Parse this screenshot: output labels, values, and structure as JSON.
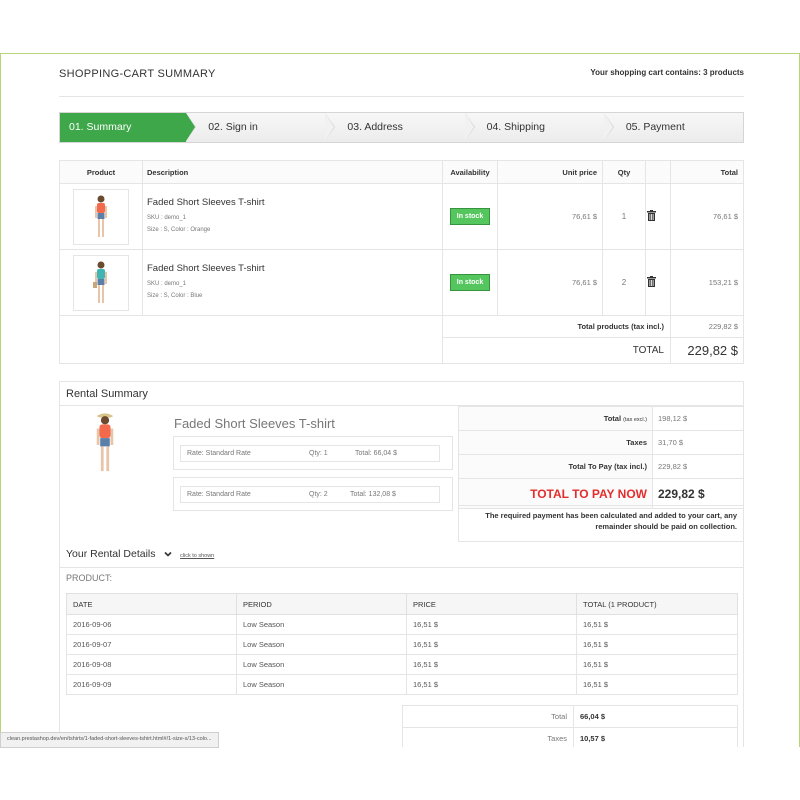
{
  "header": {
    "title": "SHOPPING-CART SUMMARY",
    "cart_count": "Your shopping cart contains: 3 products"
  },
  "steps": [
    {
      "label": "01. Summary"
    },
    {
      "label": "02. Sign in"
    },
    {
      "label": "03. Address"
    },
    {
      "label": "04. Shipping"
    },
    {
      "label": "05. Payment"
    }
  ],
  "cart": {
    "headers": {
      "product": "Product",
      "description": "Description",
      "availability": "Availability",
      "unit_price": "Unit price",
      "qty": "Qty",
      "total": "Total"
    },
    "rows": [
      {
        "name": "Faded Short Sleeves T-shirt",
        "sku": "SKU : demo_1",
        "attrs": "Size : S, Color : Orange",
        "availability": "In stock",
        "unit_price": "76,61 $",
        "qty": "1",
        "total": "76,61 $"
      },
      {
        "name": "Faded Short Sleeves T-shirt",
        "sku": "SKU : demo_1",
        "attrs": "Size : S, Color : Blue",
        "availability": "In stock",
        "unit_price": "76,61 $",
        "qty": "2",
        "total": "153,21 $"
      }
    ],
    "total_products_label": "Total products (tax incl.)",
    "total_products_value": "229,82 $",
    "total_label": "TOTAL",
    "total_value": "229,82 $"
  },
  "rental": {
    "title": "Rental Summary",
    "product_name": "Faded Short Sleeves T-shirt",
    "rates": [
      {
        "rate": "Rate: Standard Rate",
        "qty": "Qty: 1",
        "total": "Total: 66,04 $"
      },
      {
        "rate": "Rate: Standard Rate",
        "qty": "Qty: 2",
        "total": "Total: 132,08 $"
      }
    ],
    "summary": {
      "total_label": "Total",
      "total_small": "(tax excl.)",
      "total_value": "198,12 $",
      "taxes_label": "Taxes",
      "taxes_value": "31,70 $",
      "topay_label": "Total To Pay (tax incl.)",
      "topay_value": "229,82 $",
      "paynow_label": "TOTAL TO PAY NOW",
      "paynow_value": "229,82 $"
    },
    "note": "The required payment has been calculated and added to your cart, any remainder should be paid on collection.",
    "details_title": "Your Rental Details",
    "details_link": "click to shown",
    "product_label": "PRODUCT:",
    "details_headers": {
      "date": "DATE",
      "period": "PERIOD",
      "price": "PRICE",
      "total": "TOTAL (1 PRODUCT)"
    },
    "details_rows": [
      {
        "date": "2016-09-06",
        "period": "Low Season",
        "price": "16,51 $",
        "total": "16,51 $"
      },
      {
        "date": "2016-09-07",
        "period": "Low Season",
        "price": "16,51 $",
        "total": "16,51 $"
      },
      {
        "date": "2016-09-08",
        "period": "Low Season",
        "price": "16,51 $",
        "total": "16,51 $"
      },
      {
        "date": "2016-09-09",
        "period": "Low Season",
        "price": "16,51 $",
        "total": "16,51 $"
      }
    ],
    "bottom": {
      "total_label": "Total",
      "total_value": "66,04 $",
      "taxes_label": "Taxes",
      "taxes_value": "10,57 $"
    }
  },
  "statusbar": {
    "url": "clean.prestashop.dev/en/tshirts/1-faded-short-sleeves-tshirt.html#/1-size-s/13-colo..."
  },
  "colors": {
    "accent": "#3ea749",
    "instock": "#55c65e",
    "paynow": "#e42d2d",
    "frame": "#b7d47a"
  }
}
